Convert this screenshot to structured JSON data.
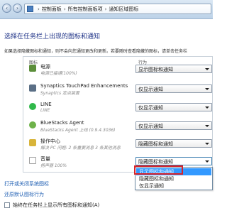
{
  "breadcrumb": [
    "控制面板",
    "所有控制面板项",
    "通知区域图标"
  ],
  "title": "选择在任务栏上出现的图标和通知",
  "description": "如果选择隐藏图标和通知，则不会向您通知更改和更新。若要随时查看隐藏的图标，请单击任务栏",
  "columns": {
    "icons": "图标",
    "behaviors": "行为"
  },
  "rows": [
    {
      "icon": "power-icon",
      "name": "电源",
      "sub": "电源已接通(100%)",
      "behavior": "显示图标和通知"
    },
    {
      "icon": "touchpad-icon",
      "name": "Synaptics TouchPad Enhancements",
      "sub": "Synaptics 定点装置",
      "behavior": "仅显示通知"
    },
    {
      "icon": "line-icon",
      "name": "LINE",
      "sub": "LINE",
      "behavior": "仅显示通知"
    },
    {
      "icon": "bluestacks-icon",
      "name": "BlueStacks Agent",
      "sub": "BlueStacks Agent 上线 (0.9.4.3036)",
      "behavior": "仅显示通知"
    },
    {
      "icon": "action-center-icon",
      "name": "操作中心",
      "sub": "解决 PC 问题: 2 条重要消息 3 条其他消息",
      "behavior": "隐藏图标和通知"
    },
    {
      "icon": "volume-icon",
      "name": "音量",
      "sub": "扬声器 100%",
      "behavior": "隐藏图标和通知"
    }
  ],
  "dropdown_options": [
    "显示图标和通知",
    "隐藏图标和通知",
    "仅显示通知"
  ],
  "selected_option_index": 0,
  "links": {
    "system_icons": "打开或关闭系统图标",
    "restore_defaults": "还原默认图标行为"
  },
  "checkbox": {
    "label": "始终在任务栏上显示所有图标和通知(A)",
    "checked": false
  },
  "colors": {
    "accent": "#3399ff",
    "highlight_border": "#d8232a",
    "title": "#1e3287"
  }
}
